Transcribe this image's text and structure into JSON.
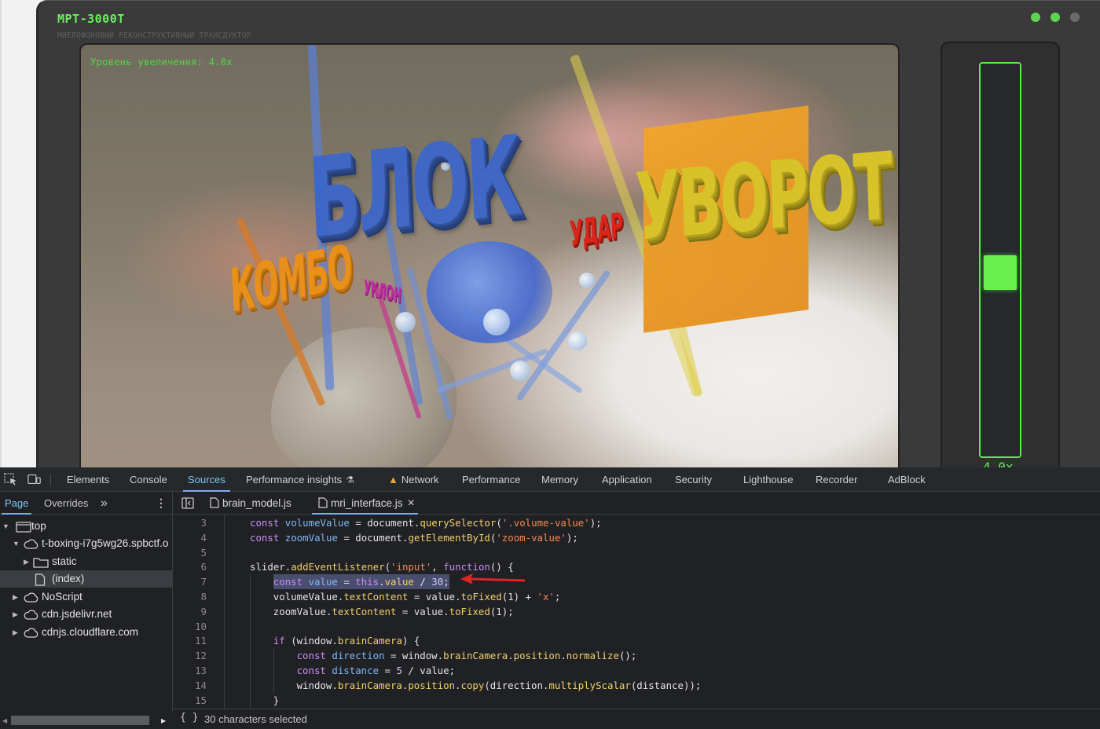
{
  "app": {
    "title": "МРТ-3000Т",
    "subtitle": "МИЕЛОФОНОВЫЙ РЕКОНСТРУКТИВНЫЙ ТРАНСДУКТОР",
    "zoom_overlay": "Уровень увеличения: 4.0x",
    "scene_words": {
      "block": "БЛОК",
      "dodge": "УВОРОТ",
      "combo": "КОМБО",
      "hit": "УДАР",
      "small": "УКЛОН"
    },
    "slider_value": "4.0x",
    "slider_level": 0.5,
    "colors": {
      "accent": "#67f05a",
      "thumb": "#6af04e"
    }
  },
  "devtools": {
    "tools": [
      "inspect-element-icon",
      "device-toolbar-icon"
    ],
    "tabs": [
      {
        "label": "Elements"
      },
      {
        "label": "Console"
      },
      {
        "label": "Sources",
        "active": true
      },
      {
        "label": "Performance insights",
        "icon": "flask-icon"
      },
      {
        "label": "Network",
        "icon": "warning-icon"
      },
      {
        "label": "Performance"
      },
      {
        "label": "Memory"
      },
      {
        "label": "Application"
      },
      {
        "label": "Security"
      },
      {
        "label": "Lighthouse"
      },
      {
        "label": "Recorder"
      },
      {
        "label": "AdBlock"
      }
    ],
    "navigator": {
      "tabs": [
        {
          "label": "Page",
          "active": true
        },
        {
          "label": "Overrides"
        }
      ],
      "more": "»",
      "tree": [
        {
          "label": "top",
          "icon": "frame-icon",
          "expanded": true
        },
        {
          "label": "t-boxing-i7g5wg26.spbctf.o",
          "icon": "cloud-icon",
          "expanded": true
        },
        {
          "label": "static",
          "icon": "folder-icon",
          "expanded": false
        },
        {
          "label": "(index)",
          "icon": "file-icon",
          "selected": true
        },
        {
          "label": "NoScript",
          "icon": "cloud-icon",
          "expanded": false
        },
        {
          "label": "cdn.jsdelivr.net",
          "icon": "cloud-icon",
          "expanded": false
        },
        {
          "label": "cdnjs.cloudflare.com",
          "icon": "cloud-icon",
          "expanded": false
        }
      ]
    },
    "editor": {
      "tabs": [
        {
          "label": "brain_model.js",
          "icon": "js-file-icon"
        },
        {
          "label": "mri_interface.js",
          "icon": "js-file-icon",
          "active": true,
          "closable": true
        }
      ],
      "lines": [
        {
          "n": "3",
          "indent": 1,
          "tokens": [
            [
              "kw",
              "const "
            ],
            [
              "var",
              "volumeValue"
            ],
            [
              "plain",
              " = document."
            ],
            [
              "fn",
              "querySelector"
            ],
            [
              "plain",
              "("
            ],
            [
              "str",
              "'.volume-value'"
            ],
            [
              "plain",
              ");"
            ]
          ]
        },
        {
          "n": "4",
          "indent": 1,
          "tokens": [
            [
              "kw",
              "const "
            ],
            [
              "var",
              "zoomValue"
            ],
            [
              "plain",
              " = document."
            ],
            [
              "fn",
              "getElementById"
            ],
            [
              "plain",
              "("
            ],
            [
              "str",
              "'zoom-value'"
            ],
            [
              "plain",
              ");"
            ]
          ]
        },
        {
          "n": "5",
          "indent": 1,
          "tokens": []
        },
        {
          "n": "6",
          "indent": 1,
          "tokens": [
            [
              "plain",
              "slider."
            ],
            [
              "fn",
              "addEventListener"
            ],
            [
              "plain",
              "("
            ],
            [
              "str",
              "'input'"
            ],
            [
              "plain",
              ", "
            ],
            [
              "kw",
              "function"
            ],
            [
              "plain",
              "() {"
            ]
          ]
        },
        {
          "n": "7",
          "indent": 2,
          "selected": true,
          "tokens": [
            [
              "kw",
              "const "
            ],
            [
              "var",
              "value"
            ],
            [
              "plain",
              " = "
            ],
            [
              "kw",
              "this"
            ],
            [
              "plain",
              "."
            ],
            [
              "fn",
              "value"
            ],
            [
              "plain",
              " / "
            ],
            [
              "num",
              "30"
            ],
            [
              "plain",
              ";"
            ]
          ]
        },
        {
          "n": "8",
          "indent": 2,
          "tokens": [
            [
              "plain",
              "volumeValue."
            ],
            [
              "fn",
              "textContent"
            ],
            [
              "plain",
              " = value."
            ],
            [
              "fn",
              "toFixed"
            ],
            [
              "plain",
              "(1) + "
            ],
            [
              "str",
              "'x'"
            ],
            [
              "plain",
              ";"
            ]
          ]
        },
        {
          "n": "9",
          "indent": 2,
          "tokens": [
            [
              "plain",
              "zoomValue."
            ],
            [
              "fn",
              "textContent"
            ],
            [
              "plain",
              " = value."
            ],
            [
              "fn",
              "toFixed"
            ],
            [
              "plain",
              "(1);"
            ]
          ]
        },
        {
          "n": "10",
          "indent": 2,
          "tokens": []
        },
        {
          "n": "11",
          "indent": 2,
          "tokens": [
            [
              "kw",
              "if "
            ],
            [
              "plain",
              "(window."
            ],
            [
              "fn",
              "brainCamera"
            ],
            [
              "plain",
              ") {"
            ]
          ]
        },
        {
          "n": "12",
          "indent": 3,
          "tokens": [
            [
              "kw",
              "const "
            ],
            [
              "var",
              "direction"
            ],
            [
              "plain",
              " = window."
            ],
            [
              "fn",
              "brainCamera"
            ],
            [
              "plain",
              "."
            ],
            [
              "fn",
              "position"
            ],
            [
              "plain",
              "."
            ],
            [
              "fn",
              "normalize"
            ],
            [
              "plain",
              "();"
            ]
          ]
        },
        {
          "n": "13",
          "indent": 3,
          "tokens": [
            [
              "kw",
              "const "
            ],
            [
              "var",
              "distance"
            ],
            [
              "plain",
              " = "
            ],
            [
              "num",
              "5"
            ],
            [
              "plain",
              " / value;"
            ]
          ]
        },
        {
          "n": "14",
          "indent": 3,
          "tokens": [
            [
              "plain",
              "window."
            ],
            [
              "fn",
              "brainCamera"
            ],
            [
              "plain",
              "."
            ],
            [
              "fn",
              "position"
            ],
            [
              "plain",
              "."
            ],
            [
              "fn",
              "copy"
            ],
            [
              "plain",
              "(direction."
            ],
            [
              "fn",
              "multiplyScalar"
            ],
            [
              "plain",
              "(distance));"
            ]
          ]
        },
        {
          "n": "15",
          "indent": 2,
          "tokens": [
            [
              "plain",
              "}"
            ]
          ]
        }
      ],
      "status": "30 characters selected",
      "status_icon": "{ }"
    }
  }
}
